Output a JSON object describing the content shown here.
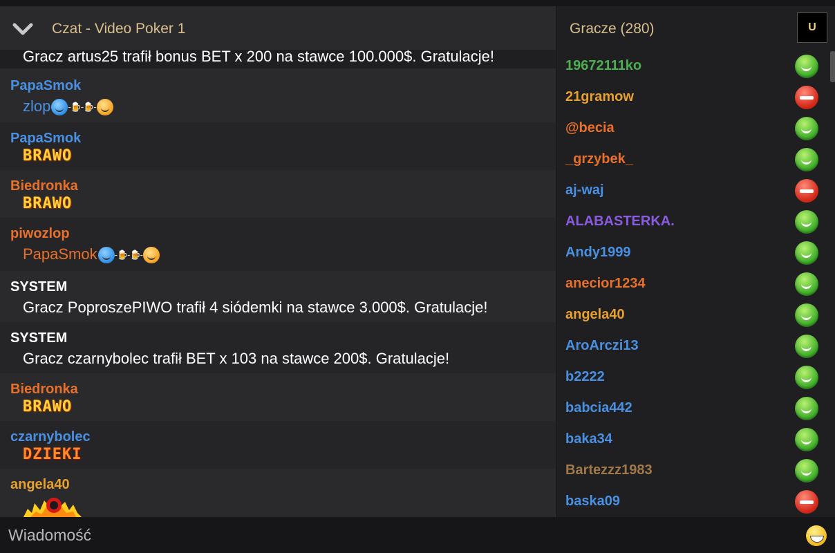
{
  "chat": {
    "title": "Czat - Video Poker 1",
    "first_message": "Gracz artus25 trafił bonus BET x 200 na stawce 100.000$. Gratulacje!",
    "messages": [
      {
        "user": "PapaSmok",
        "text": "zlop",
        "color": "#4a90e2"
      },
      {
        "user": "PapaSmok",
        "text": "BRAWO",
        "color": "#4a90e2"
      },
      {
        "user": "Biedronka",
        "text": "BRAWO",
        "color": "#e8702a"
      },
      {
        "user": "piwozlop",
        "text": "PapaSmok",
        "color": "#e8702a"
      },
      {
        "user": "SYSTEM",
        "text": "Gracz PoproszePIWO trafił 4 siódemki na stawce 3.000$. Gratulacje!",
        "color": "#ffffff"
      },
      {
        "user": "SYSTEM",
        "text": "Gracz czarnybolec trafił BET x 103 na stawce 200$. Gratulacje!",
        "color": "#ffffff"
      },
      {
        "user": "Biedronka",
        "text": "BRAWO",
        "color": "#e8702a"
      },
      {
        "user": "czarnybolec",
        "text": "DZIEKI",
        "color": "#4a90e2"
      },
      {
        "user": "angela40",
        "text": "",
        "color": "#e8a030"
      }
    ]
  },
  "players": {
    "title": "Gracze  (280)",
    "u_button": "U",
    "list": [
      {
        "name": "19672111ko",
        "color": "#4caf50",
        "status": "online"
      },
      {
        "name": "21gramow",
        "color": "#e8a030",
        "status": "busy"
      },
      {
        "name": "@becia",
        "color": "#e8702a",
        "status": "online"
      },
      {
        "name": "_grzybek_",
        "color": "#e8702a",
        "status": "online"
      },
      {
        "name": "aj-waj",
        "color": "#4a90e2",
        "status": "busy"
      },
      {
        "name": "ALABASTERKA.",
        "color": "#8a5ce0",
        "status": "online"
      },
      {
        "name": "Andy1999",
        "color": "#4a90e2",
        "status": "online"
      },
      {
        "name": "anecior1234",
        "color": "#e8702a",
        "status": "online"
      },
      {
        "name": "angela40",
        "color": "#e8a030",
        "status": "online"
      },
      {
        "name": "AroArczi13",
        "color": "#4a90e2",
        "status": "online"
      },
      {
        "name": "b2222",
        "color": "#4a90e2",
        "status": "online"
      },
      {
        "name": "babcia442",
        "color": "#4a90e2",
        "status": "online"
      },
      {
        "name": "baka34",
        "color": "#4a90e2",
        "status": "online"
      },
      {
        "name": "Bartezzz1983",
        "color": "#a0784a",
        "status": "online"
      },
      {
        "name": "baska09",
        "color": "#4a90e2",
        "status": "busy"
      }
    ]
  },
  "input": {
    "placeholder": "Wiadomość",
    "emoji_icon": "smiley-icon"
  }
}
